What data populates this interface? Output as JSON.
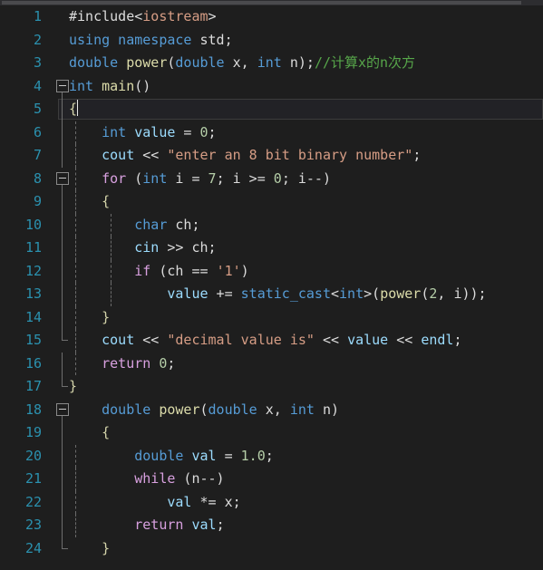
{
  "editor": {
    "app": "code-editor",
    "language": "C++",
    "theme_background": "#1e1e1e",
    "line_number_color": "#2b91af",
    "cursor_line": 5,
    "total_lines": 24,
    "scrollbar": {
      "orientation": "horizontal",
      "position": "top"
    },
    "colors": {
      "keyword": "#569cd6",
      "control": "#d8a0df",
      "string": "#d69d85",
      "comment": "#57a64a",
      "number": "#b5cea8",
      "function": "#dcdcaa",
      "identifier": "#9cdcfe",
      "plain": "#dcdcdc",
      "brace": "#d4d4aa"
    }
  },
  "lines": [
    {
      "n": "1",
      "fold": "none",
      "guides": 0,
      "text": "#include<iostream>"
    },
    {
      "n": "2",
      "fold": "none",
      "guides": 0,
      "text": "using namespace std;"
    },
    {
      "n": "3",
      "fold": "none",
      "guides": 0,
      "text": "double power(double x, int n);//计算x的n次方"
    },
    {
      "n": "4",
      "fold": "open",
      "guides": 0,
      "text": "int main()"
    },
    {
      "n": "5",
      "fold": "line",
      "guides": 0,
      "text": "{"
    },
    {
      "n": "6",
      "fold": "line",
      "guides": 1,
      "text": "    int value = 0;"
    },
    {
      "n": "7",
      "fold": "line",
      "guides": 1,
      "text": "    cout << \"enter an 8 bit binary number\";"
    },
    {
      "n": "8",
      "fold": "open",
      "guides": 1,
      "text": "    for (int i = 7; i >= 0; i--)"
    },
    {
      "n": "9",
      "fold": "line",
      "guides": 1,
      "text": "    {"
    },
    {
      "n": "10",
      "fold": "line",
      "guides": 2,
      "text": "        char ch;"
    },
    {
      "n": "11",
      "fold": "line",
      "guides": 2,
      "text": "        cin >> ch;"
    },
    {
      "n": "12",
      "fold": "line",
      "guides": 2,
      "text": "        if (ch == '1')"
    },
    {
      "n": "13",
      "fold": "line",
      "guides": 2,
      "text": "            value += static_cast<int>(power(2, i));"
    },
    {
      "n": "14",
      "fold": "line",
      "guides": 1,
      "text": "    }"
    },
    {
      "n": "15",
      "fold": "end",
      "guides": 1,
      "text": "    cout << \"decimal value is\" << value << endl;"
    },
    {
      "n": "16",
      "fold": "line",
      "guides": 1,
      "text": "    return 0;"
    },
    {
      "n": "17",
      "fold": "end",
      "guides": 0,
      "text": "}"
    },
    {
      "n": "18",
      "fold": "open",
      "guides": 0,
      "text": "    double power(double x, int n)"
    },
    {
      "n": "19",
      "fold": "line",
      "guides": 0,
      "text": "    {"
    },
    {
      "n": "20",
      "fold": "line",
      "guides": 1,
      "text": "        double val = 1.0;"
    },
    {
      "n": "21",
      "fold": "line",
      "guides": 1,
      "text": "        while (n--)"
    },
    {
      "n": "22",
      "fold": "line",
      "guides": 1,
      "text": "            val *= x;"
    },
    {
      "n": "23",
      "fold": "line",
      "guides": 1,
      "text": "        return val;"
    },
    {
      "n": "24",
      "fold": "end",
      "guides": 0,
      "text": "    }"
    }
  ],
  "tokens": {
    "l1": [
      [
        "pp",
        "#include"
      ],
      [
        "plain",
        "<"
      ],
      [
        "str",
        "iostream"
      ],
      [
        "plain",
        ">"
      ]
    ],
    "l2": [
      [
        "kw",
        "using namespace"
      ],
      [
        "plain",
        " "
      ],
      [
        "plain",
        "std"
      ],
      [
        "plain",
        ";"
      ]
    ],
    "l3": [
      [
        "kw",
        "double"
      ],
      [
        "plain",
        " "
      ],
      [
        "fn",
        "power"
      ],
      [
        "plain",
        "("
      ],
      [
        "kw",
        "double"
      ],
      [
        "plain",
        " x, "
      ],
      [
        "kw",
        "int"
      ],
      [
        "plain",
        " n);"
      ],
      [
        "cmt",
        "//计算x的n次方"
      ]
    ],
    "l4": [
      [
        "kw",
        "int"
      ],
      [
        "plain",
        " "
      ],
      [
        "fn",
        "main"
      ],
      [
        "plain",
        "()"
      ]
    ],
    "l5": [
      [
        "brace",
        "{"
      ]
    ],
    "l6": [
      [
        "plain",
        "    "
      ],
      [
        "kw",
        "int"
      ],
      [
        "plain",
        " "
      ],
      [
        "var",
        "value"
      ],
      [
        "plain",
        " = "
      ],
      [
        "num",
        "0"
      ],
      [
        "plain",
        ";"
      ]
    ],
    "l7": [
      [
        "plain",
        "    "
      ],
      [
        "var",
        "cout"
      ],
      [
        "plain",
        " << "
      ],
      [
        "str",
        "\"enter an 8 bit binary number\""
      ],
      [
        "plain",
        ";"
      ]
    ],
    "l8": [
      [
        "plain",
        "    "
      ],
      [
        "ctl",
        "for"
      ],
      [
        "plain",
        " ("
      ],
      [
        "kw",
        "int"
      ],
      [
        "plain",
        " i = "
      ],
      [
        "num",
        "7"
      ],
      [
        "plain",
        "; i >= "
      ],
      [
        "num",
        "0"
      ],
      [
        "plain",
        "; i--)"
      ]
    ],
    "l9": [
      [
        "plain",
        "    "
      ],
      [
        "brace",
        "{"
      ]
    ],
    "l10": [
      [
        "plain",
        "        "
      ],
      [
        "kw",
        "char"
      ],
      [
        "plain",
        " ch;"
      ]
    ],
    "l11": [
      [
        "plain",
        "        "
      ],
      [
        "var",
        "cin"
      ],
      [
        "plain",
        " >> ch;"
      ]
    ],
    "l12": [
      [
        "plain",
        "        "
      ],
      [
        "ctl",
        "if"
      ],
      [
        "plain",
        " (ch == "
      ],
      [
        "str",
        "'1'"
      ],
      [
        "plain",
        ")"
      ]
    ],
    "l13": [
      [
        "plain",
        "            "
      ],
      [
        "var",
        "value"
      ],
      [
        "plain",
        " += "
      ],
      [
        "kw",
        "static_cast"
      ],
      [
        "plain",
        "<"
      ],
      [
        "kw",
        "int"
      ],
      [
        "plain",
        ">("
      ],
      [
        "fn",
        "power"
      ],
      [
        "plain",
        "("
      ],
      [
        "num",
        "2"
      ],
      [
        "plain",
        ", i));"
      ]
    ],
    "l14": [
      [
        "plain",
        "    "
      ],
      [
        "brace",
        "}"
      ]
    ],
    "l15": [
      [
        "plain",
        "    "
      ],
      [
        "var",
        "cout"
      ],
      [
        "plain",
        " << "
      ],
      [
        "str",
        "\"decimal value is\""
      ],
      [
        "plain",
        " << "
      ],
      [
        "var",
        "value"
      ],
      [
        "plain",
        " << "
      ],
      [
        "var",
        "endl"
      ],
      [
        "plain",
        ";"
      ]
    ],
    "l16": [
      [
        "plain",
        "    "
      ],
      [
        "ctl",
        "return"
      ],
      [
        "plain",
        " "
      ],
      [
        "num",
        "0"
      ],
      [
        "plain",
        ";"
      ]
    ],
    "l17": [
      [
        "brace",
        "}"
      ]
    ],
    "l18": [
      [
        "plain",
        "    "
      ],
      [
        "kw",
        "double"
      ],
      [
        "plain",
        " "
      ],
      [
        "fn",
        "power"
      ],
      [
        "plain",
        "("
      ],
      [
        "kw",
        "double"
      ],
      [
        "plain",
        " x, "
      ],
      [
        "kw",
        "int"
      ],
      [
        "plain",
        " n)"
      ]
    ],
    "l19": [
      [
        "plain",
        "    "
      ],
      [
        "brace",
        "{"
      ]
    ],
    "l20": [
      [
        "plain",
        "        "
      ],
      [
        "kw",
        "double"
      ],
      [
        "plain",
        " "
      ],
      [
        "var",
        "val"
      ],
      [
        "plain",
        " = "
      ],
      [
        "num",
        "1.0"
      ],
      [
        "plain",
        ";"
      ]
    ],
    "l21": [
      [
        "plain",
        "        "
      ],
      [
        "ctl",
        "while"
      ],
      [
        "plain",
        " (n--)"
      ]
    ],
    "l22": [
      [
        "plain",
        "            "
      ],
      [
        "var",
        "val"
      ],
      [
        "plain",
        " *= x;"
      ]
    ],
    "l23": [
      [
        "plain",
        "        "
      ],
      [
        "ctl",
        "return"
      ],
      [
        "plain",
        " "
      ],
      [
        "var",
        "val"
      ],
      [
        "plain",
        ";"
      ]
    ],
    "l24": [
      [
        "plain",
        "    "
      ],
      [
        "brace",
        "}"
      ]
    ]
  }
}
